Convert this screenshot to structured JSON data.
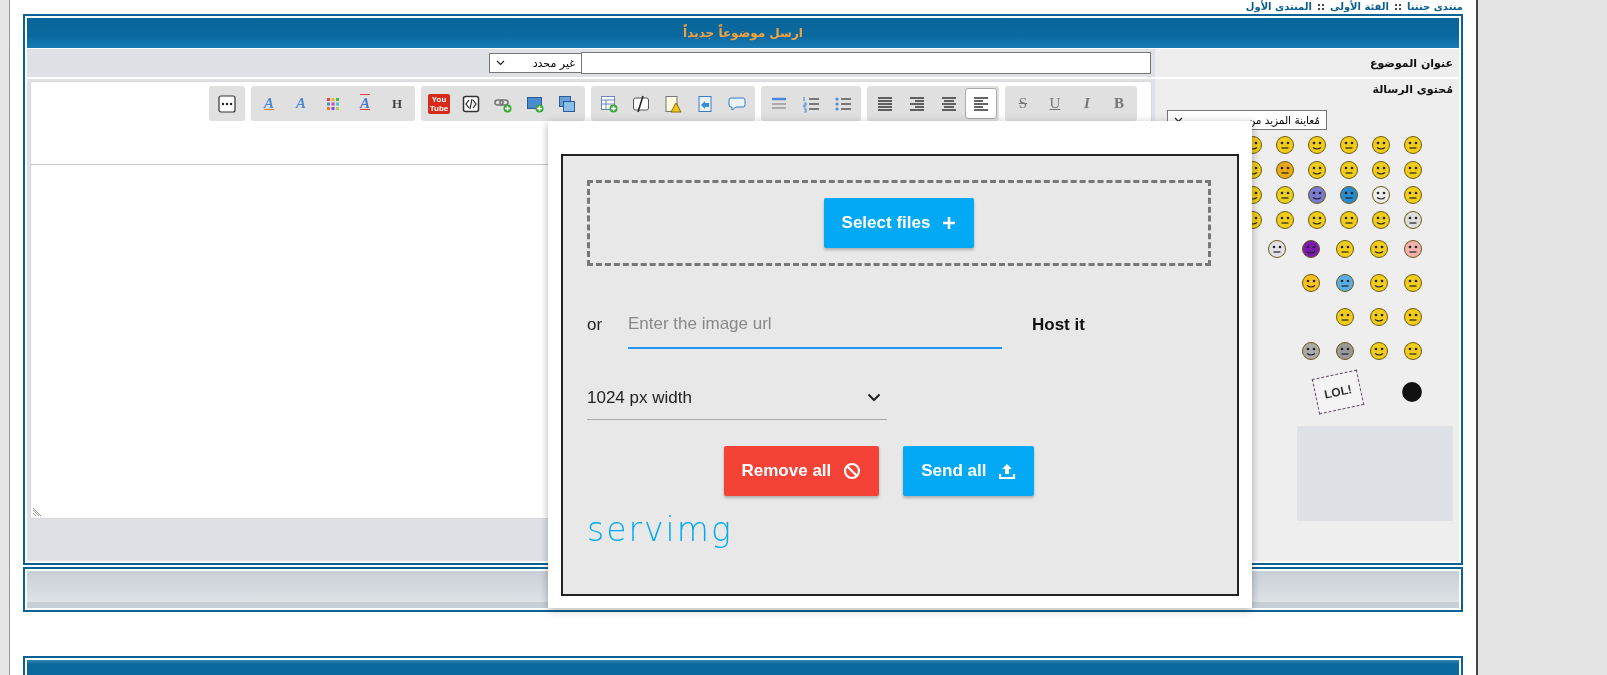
{
  "breadcrumb": {
    "separator": "::",
    "items": [
      {
        "label": "منتدى جنتنا"
      },
      {
        "label": "الفئة الأولى"
      },
      {
        "label": "المنتدى الأول"
      }
    ]
  },
  "form": {
    "title": "ارسل موضوعاً جديداً",
    "subject_label": "عنوان الموضوع",
    "type_select": "غير محدد",
    "message_label": "مُحتوى الرسالة",
    "smiley_select": "مُعاينة المزيد من",
    "lol_sign": "LOL!"
  },
  "toolbar": [
    [
      {
        "kind": "text",
        "label": "B",
        "selected": false
      },
      {
        "kind": "text",
        "label": "I",
        "selected": false
      },
      {
        "kind": "text",
        "label": "U",
        "selected": false
      },
      {
        "kind": "text",
        "label": "S",
        "selected": false
      }
    ],
    [
      {
        "kind": "icon",
        "selected": true
      },
      {
        "kind": "icon",
        "selected": false
      },
      {
        "kind": "icon",
        "selected": false
      },
      {
        "kind": "icon",
        "selected": false
      }
    ],
    [
      {
        "kind": "icon",
        "selected": false
      },
      {
        "kind": "icon",
        "selected": false
      },
      {
        "kind": "icon",
        "selected": false
      }
    ],
    [
      {
        "kind": "icon",
        "selected": false
      },
      {
        "kind": "icon",
        "selected": false
      },
      {
        "kind": "icon",
        "selected": false
      },
      {
        "kind": "icon",
        "selected": false
      },
      {
        "kind": "icon",
        "selected": false
      }
    ],
    [
      {
        "kind": "icon",
        "selected": false
      },
      {
        "kind": "icon",
        "selected": false
      },
      {
        "kind": "icon",
        "selected": false
      },
      {
        "kind": "icon",
        "selected": false
      },
      {
        "kind": "logo",
        "label": "You\nTube",
        "selected": false
      }
    ],
    [
      {
        "kind": "text",
        "label": "H",
        "selected": false
      },
      {
        "kind": "text",
        "label": "A",
        "selected": false
      },
      {
        "kind": "icon",
        "selected": false
      },
      {
        "kind": "text",
        "label": "A",
        "selected": false
      },
      {
        "kind": "text",
        "label": "A",
        "selected": false
      }
    ],
    [
      {
        "kind": "icon",
        "selected": false
      }
    ]
  ],
  "upload_dialog": {
    "select_files": "Select files",
    "or": "or",
    "url_placeholder": "Enter the image url",
    "host": "Host it",
    "size": "1024 px width",
    "remove_all": "Remove all",
    "send_all": "Send all",
    "brand": "servimg"
  }
}
